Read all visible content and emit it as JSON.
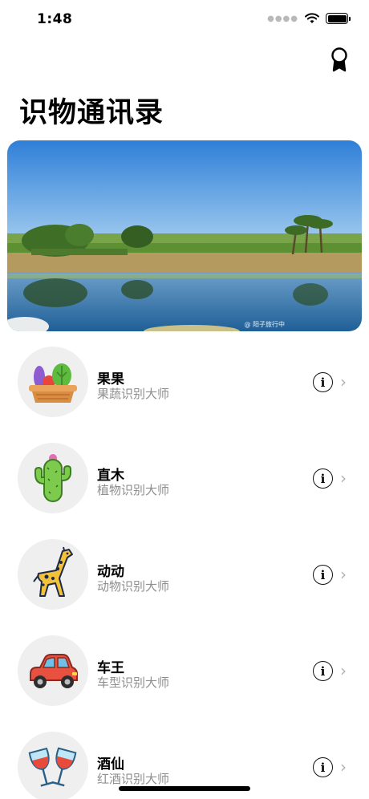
{
  "status_bar": {
    "time": "1:48"
  },
  "header": {
    "title": "识物通讯录",
    "award_icon": "award-ribbon-icon"
  },
  "banner": {
    "watermark": "@ 阳子旅行中"
  },
  "items": [
    {
      "title": "果果",
      "subtitle": "果蔬识别大师",
      "icon": "fruit-basket-icon"
    },
    {
      "title": "直木",
      "subtitle": "植物识别大师",
      "icon": "cactus-icon"
    },
    {
      "title": "动动",
      "subtitle": "动物识别大师",
      "icon": "giraffe-icon"
    },
    {
      "title": "车王",
      "subtitle": "车型识别大师",
      "icon": "car-icon"
    },
    {
      "title": "酒仙",
      "subtitle": "红酒识别大师",
      "icon": "wine-glasses-icon"
    }
  ],
  "info_symbol": "i",
  "chevron_symbol": "›"
}
